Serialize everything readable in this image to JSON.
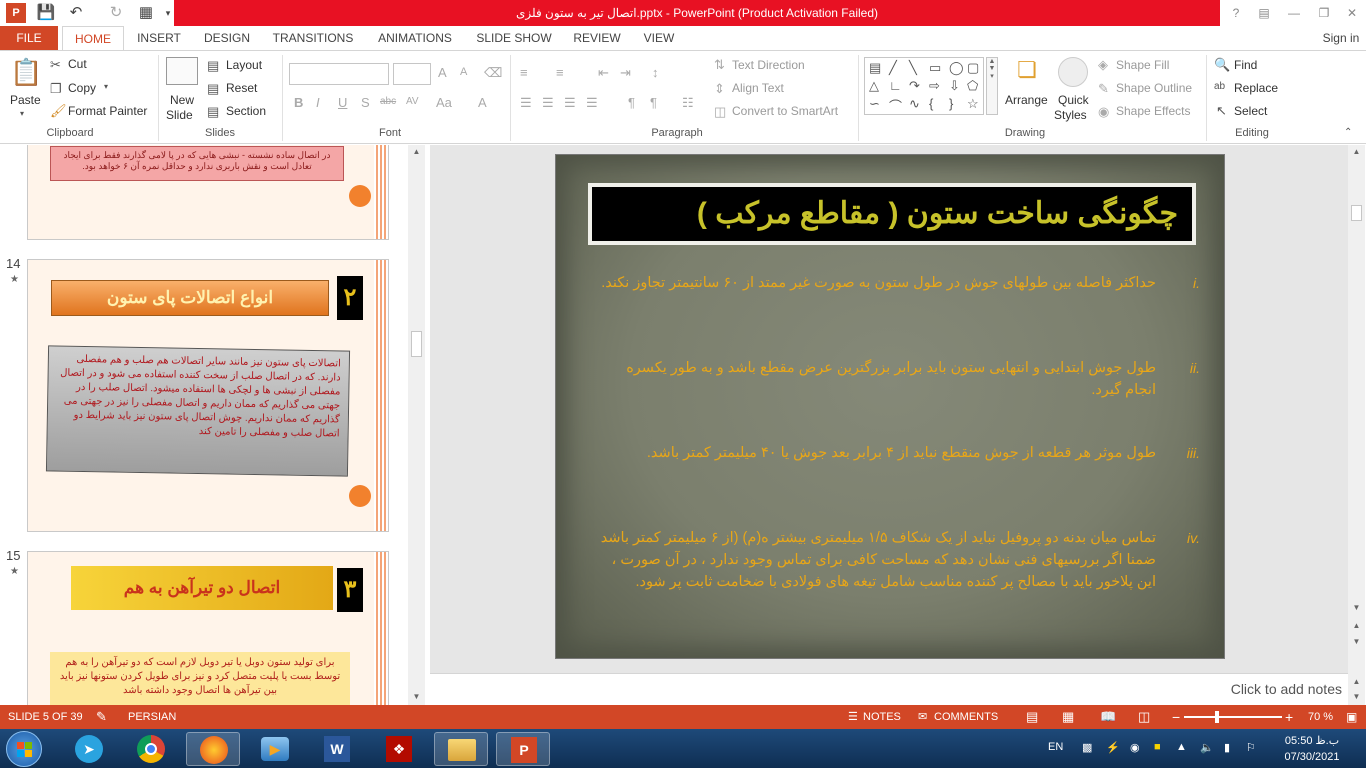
{
  "app": {
    "title": "اتصال تیر به ستون فلزی.pptx - PowerPoint (Product Activation Failed)",
    "help": "?",
    "sign_in": "Sign in"
  },
  "tabs": [
    "FILE",
    "HOME",
    "INSERT",
    "DESIGN",
    "TRANSITIONS",
    "ANIMATIONS",
    "SLIDE SHOW",
    "REVIEW",
    "VIEW"
  ],
  "active_tab": "HOME",
  "ribbon": {
    "clipboard": {
      "paste": "Paste",
      "cut": "Cut",
      "copy": "Copy",
      "format_painter": "Format Painter",
      "label": "Clipboard"
    },
    "slides": {
      "new_slide_1": "New",
      "new_slide_2": "Slide",
      "layout": "Layout",
      "reset": "Reset",
      "section": "Section",
      "label": "Slides"
    },
    "font": {
      "label": "Font",
      "bold": "B",
      "italic": "I",
      "underline": "U",
      "shadow": "S",
      "strike": "abc",
      "spacing": "AV",
      "case": "Aa",
      "color": "A",
      "grow": "A",
      "shrink": "A"
    },
    "paragraph": {
      "label": "Paragraph",
      "text_direction": "Text Direction",
      "align_text": "Align Text",
      "smartart": "Convert to SmartArt"
    },
    "drawing": {
      "label": "Drawing",
      "arrange": "Arrange",
      "quick_1": "Quick",
      "quick_2": "Styles",
      "shape_fill": "Shape Fill",
      "shape_outline": "Shape Outline",
      "shape_effects": "Shape Effects"
    },
    "editing": {
      "label": "Editing",
      "find": "Find",
      "replace": "Replace",
      "select": "Select"
    }
  },
  "thumbnails": {
    "slide13": {
      "text": "در اتصال ساده نشسته - نبشی هایی که در پا لامی گذارند فقط برای ایجاد تعادل است و نقش باربری ندارد و حداقل نمره آن ۶ خواهد بود."
    },
    "slide14": {
      "number": "14",
      "star": "★",
      "badge": "۲",
      "title": "انواع اتصالات پای ستون",
      "body": "اتصالات پای ستون نیز مانند سایر اتصالات هم صلب و هم مفصلی دارند. که در اتصال صلب از سخت کننده استفاده می شود و در اتصال مفصلی از نبشی ها و لچکی ها استفاده میشود. اتصال صلب را در جهتی می گذاریم که ممان داریم و اتصال مفصلی را نیز در جهتی می گذاریم که ممان نداریم. چوش اتصال پای ستون نیز باید شرایط دو اتصال صلب و مفصلی را تامین کند"
    },
    "slide15": {
      "number": "15",
      "star": "★",
      "badge": "۳",
      "title": "اتصال دو تیرآهن به هم",
      "body": "برای تولید ستون دوبل یا تیر دوبل لازم است که دو تیرآهن را به هم توسط بست یا پلیت متصل کرد و نیز برای طویل کردن ستونها نیز باید بین تیرآهن ها اتصال وجود داشته باشد"
    }
  },
  "slide": {
    "title": "چگونگی ساخت ستون ( مقاطع مرکب )",
    "items": [
      {
        "num": "i.",
        "text": "حداکثر فاصله بین طولهای جوش در طول ستون به صورت غیر ممتد از ۶۰ سانتیمتر تجاوز نکند."
      },
      {
        "num": "ii.",
        "text": "طول جوش ابتدایی و انتهایی ستون باید برابر بزرگترین عرض مقطع باشد و به طور یکسره انجام گیرد."
      },
      {
        "num": "iii.",
        "text": "طول موثر هر قطعه از جوش منقطع نباید از ۴ برابر بعد جوش یا ۴۰ میلیمتر کمتر باشد."
      },
      {
        "num": "iv.",
        "text": "تماس میان بدنه دو پروفیل نباید از یک شکاف ۱/۵ میلیمتری بیشتر ه(م) (از ۶ میلیمتر کمتر باشد ضمنا اگر بررسیهای فنی نشان دهد که مساحت کافی برای تماس وجود ندارد ، در آن صورت ، این پلاخور باید با مصالح پر کننده مناسب شامل تیغه های فولادی با ضخامت ثابت پر شود."
      }
    ]
  },
  "notes_placeholder": "Click to add notes",
  "status": {
    "slide_of": "SLIDE 5 OF 39",
    "language": "PERSIAN",
    "notes": "NOTES",
    "comments": "COMMENTS",
    "zoom": "70 %",
    "zoom_level": 0.7
  },
  "taskbar": {
    "lang": "EN",
    "time": "05:50 ب.ظ",
    "date": "07/30/2021",
    "apps": [
      "start",
      "telegram",
      "chrome",
      "firefox",
      "media-player",
      "word",
      "acrobat",
      "file-explorer",
      "powerpoint"
    ]
  },
  "colors": {
    "accent": "#d24726",
    "title_bar": "#e81123",
    "slide_text": "#e8a618",
    "slide_title": "#c7c22a"
  }
}
